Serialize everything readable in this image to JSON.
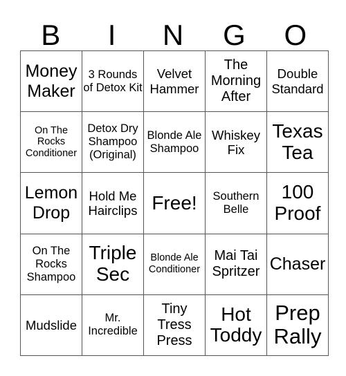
{
  "header": {
    "letters": [
      "B",
      "I",
      "N",
      "G",
      "O"
    ]
  },
  "grid": [
    [
      {
        "text": "Money Maker",
        "size": "s24"
      },
      {
        "text": "3 Rounds of Detox Kit",
        "size": "s16"
      },
      {
        "text": "Velvet Hammer",
        "size": "s18"
      },
      {
        "text": "The Morning After",
        "size": "s20"
      },
      {
        "text": "Double Standard",
        "size": "s18"
      }
    ],
    [
      {
        "text": "On The Rocks Conditioner",
        "size": "s14"
      },
      {
        "text": "Detox Dry Shampoo (Original)",
        "size": "s16"
      },
      {
        "text": "Blonde Ale Shampoo",
        "size": "s16"
      },
      {
        "text": "Whiskey Fix",
        "size": "s18"
      },
      {
        "text": "Texas Tea",
        "size": "s28"
      }
    ],
    [
      {
        "text": "Lemon Drop",
        "size": "s24"
      },
      {
        "text": "Hold Me Hairclips",
        "size": "s18"
      },
      {
        "text": "Free!",
        "size": "s28"
      },
      {
        "text": "Southern Belle",
        "size": "s16"
      },
      {
        "text": "100 Proof",
        "size": "s28"
      }
    ],
    [
      {
        "text": "On The Rocks Shampoo",
        "size": "s16"
      },
      {
        "text": "Triple Sec",
        "size": "s28"
      },
      {
        "text": "Blonde Ale Conditioner",
        "size": "s14"
      },
      {
        "text": "Mai Tai Spritzer",
        "size": "s20"
      },
      {
        "text": "Chaser",
        "size": "s24"
      }
    ],
    [
      {
        "text": "Mudslide",
        "size": "s18"
      },
      {
        "text": "Mr. Incredible",
        "size": "s16"
      },
      {
        "text": "Tiny Tress Press",
        "size": "s20"
      },
      {
        "text": "Hot Toddy",
        "size": "s28"
      },
      {
        "text": "Prep Rally",
        "size": "s32"
      }
    ]
  ]
}
